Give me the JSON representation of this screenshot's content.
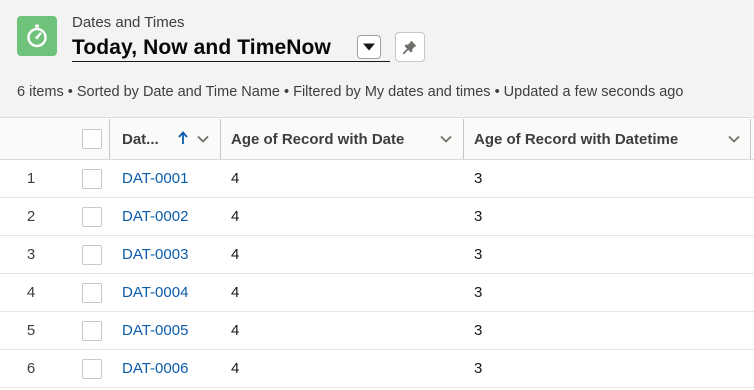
{
  "header": {
    "object_type": "Dates and Times",
    "list_title": "Today, Now and TimeNow",
    "summary": "6 items • Sorted by Date and Time Name • Filtered by My dates and times • Updated a few seconds ago",
    "icon": "stopwatch-icon",
    "icon_color": "#6fc27a"
  },
  "table": {
    "columns": [
      {
        "label": "Dat...",
        "sort": "ascending"
      },
      {
        "label": "Age of Record with Date"
      },
      {
        "label": "Age of Record with Datetime"
      }
    ],
    "rows": [
      {
        "num": "1",
        "name": "DAT-0001",
        "age_date": "4",
        "age_datetime": "3"
      },
      {
        "num": "2",
        "name": "DAT-0002",
        "age_date": "4",
        "age_datetime": "3"
      },
      {
        "num": "3",
        "name": "DAT-0003",
        "age_date": "4",
        "age_datetime": "3"
      },
      {
        "num": "4",
        "name": "DAT-0004",
        "age_date": "4",
        "age_datetime": "3"
      },
      {
        "num": "5",
        "name": "DAT-0005",
        "age_date": "4",
        "age_datetime": "3"
      },
      {
        "num": "6",
        "name": "DAT-0006",
        "age_date": "4",
        "age_datetime": "3"
      }
    ]
  }
}
